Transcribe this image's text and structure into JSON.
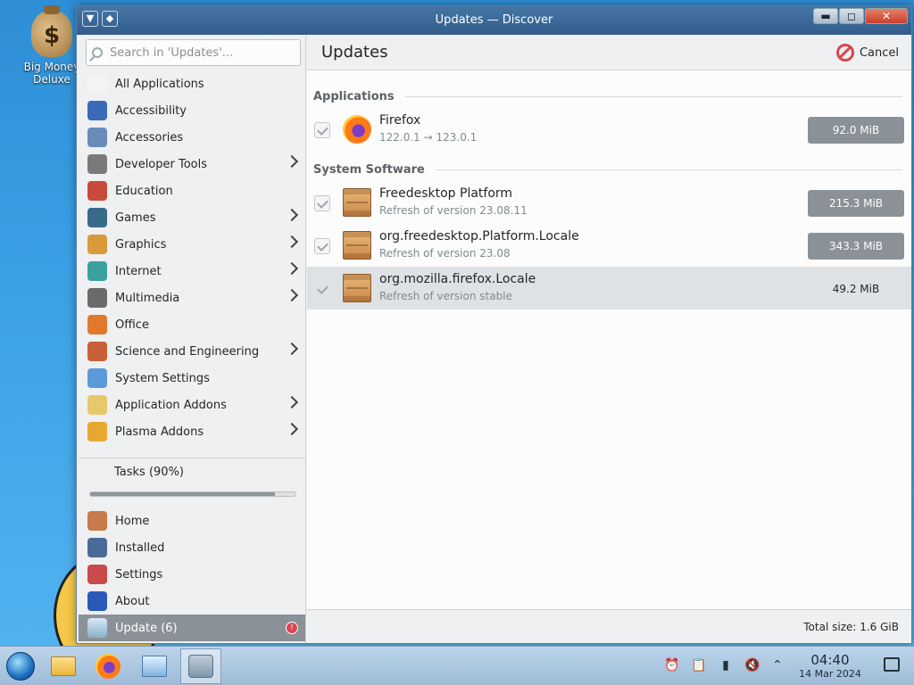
{
  "desktop": {
    "icon_label": "Big Money Deluxe",
    "icon_glyph": "$"
  },
  "window": {
    "title": "Updates — Discover",
    "title_buttons": [
      "▼",
      "◆"
    ],
    "controls": {
      "minimize": "▬",
      "maximize": "◻",
      "close": "✕"
    }
  },
  "sidebar": {
    "search_placeholder": "Search in 'Updates'...",
    "categories": [
      {
        "label": "All Applications",
        "submenu": false,
        "icon": "grid-icon",
        "color": "#f4f4f4"
      },
      {
        "label": "Accessibility",
        "submenu": false,
        "icon": "accessibility-icon",
        "color": "#3a6ab8"
      },
      {
        "label": "Accessories",
        "submenu": false,
        "icon": "accessories-icon",
        "color": "#6a8bb8"
      },
      {
        "label": "Developer Tools",
        "submenu": true,
        "icon": "developer-tools-icon",
        "color": "#7a7a7a"
      },
      {
        "label": "Education",
        "submenu": false,
        "icon": "education-icon",
        "color": "#c84a3a"
      },
      {
        "label": "Games",
        "submenu": true,
        "icon": "games-icon",
        "color": "#3a6a8a"
      },
      {
        "label": "Graphics",
        "submenu": true,
        "icon": "graphics-icon",
        "color": "#d89a3a"
      },
      {
        "label": "Internet",
        "submenu": true,
        "icon": "internet-icon",
        "color": "#3aa0a0"
      },
      {
        "label": "Multimedia",
        "submenu": true,
        "icon": "multimedia-icon",
        "color": "#6a6a6a"
      },
      {
        "label": "Office",
        "submenu": false,
        "icon": "office-icon",
        "color": "#e07a2a"
      },
      {
        "label": "Science and Engineering",
        "submenu": true,
        "icon": "science-icon",
        "color": "#c8603a"
      },
      {
        "label": "System Settings",
        "submenu": false,
        "icon": "system-settings-icon",
        "color": "#5a9ad8"
      },
      {
        "label": "Application Addons",
        "submenu": true,
        "icon": "application-addons-icon",
        "color": "#e8c86a"
      },
      {
        "label": "Plasma Addons",
        "submenu": true,
        "icon": "plasma-addons-icon",
        "color": "#e8a830"
      }
    ],
    "tasks_label": "Tasks (90%)",
    "tasks_progress": 0.9,
    "nav": [
      {
        "label": "Home",
        "icon": "home-icon",
        "color": "#c87a4a"
      },
      {
        "label": "Installed",
        "icon": "installed-icon",
        "color": "#4a6a9a"
      },
      {
        "label": "Settings",
        "icon": "settings-icon",
        "color": "#c84a4a"
      },
      {
        "label": "About",
        "icon": "about-icon",
        "color": "#2a5ab8"
      }
    ],
    "update_label": "Update (6)",
    "update_badge": "!"
  },
  "main": {
    "title": "Updates",
    "cancel_label": "Cancel",
    "sections": [
      {
        "label": "Applications"
      },
      {
        "label": "System Software"
      }
    ],
    "rows": [
      {
        "name": "Firefox",
        "desc": "122.0.1 → 123.0.1",
        "size": "92.0 MiB",
        "icon": "firefox-icon",
        "checked": true
      },
      {
        "name": "Freedesktop Platform",
        "desc": "Refresh of version 23.08.11",
        "size": "215.3 MiB",
        "icon": "package-icon",
        "checked": true
      },
      {
        "name": "org.freedesktop.Platform.Locale",
        "desc": "Refresh of version 23.08",
        "size": "343.3 MiB",
        "icon": "package-icon",
        "checked": true
      },
      {
        "name": "org.mozilla.firefox.Locale",
        "desc": "Refresh of version stable",
        "size": "49.2 MiB",
        "icon": "package-icon",
        "checked": true,
        "highlighted": true
      }
    ],
    "total_size": "Total size: 1.6 GiB"
  },
  "taskbar": {
    "clock_time": "04:40",
    "clock_date": "14 Mar 2024",
    "tray_glyphs": {
      "alarm": "⏰",
      "clipboard": "📋",
      "battery": "▮",
      "volume": "🔇",
      "expand": "⌃"
    }
  },
  "colors": {
    "accent": "#8a9297",
    "badge": "#da4453"
  }
}
